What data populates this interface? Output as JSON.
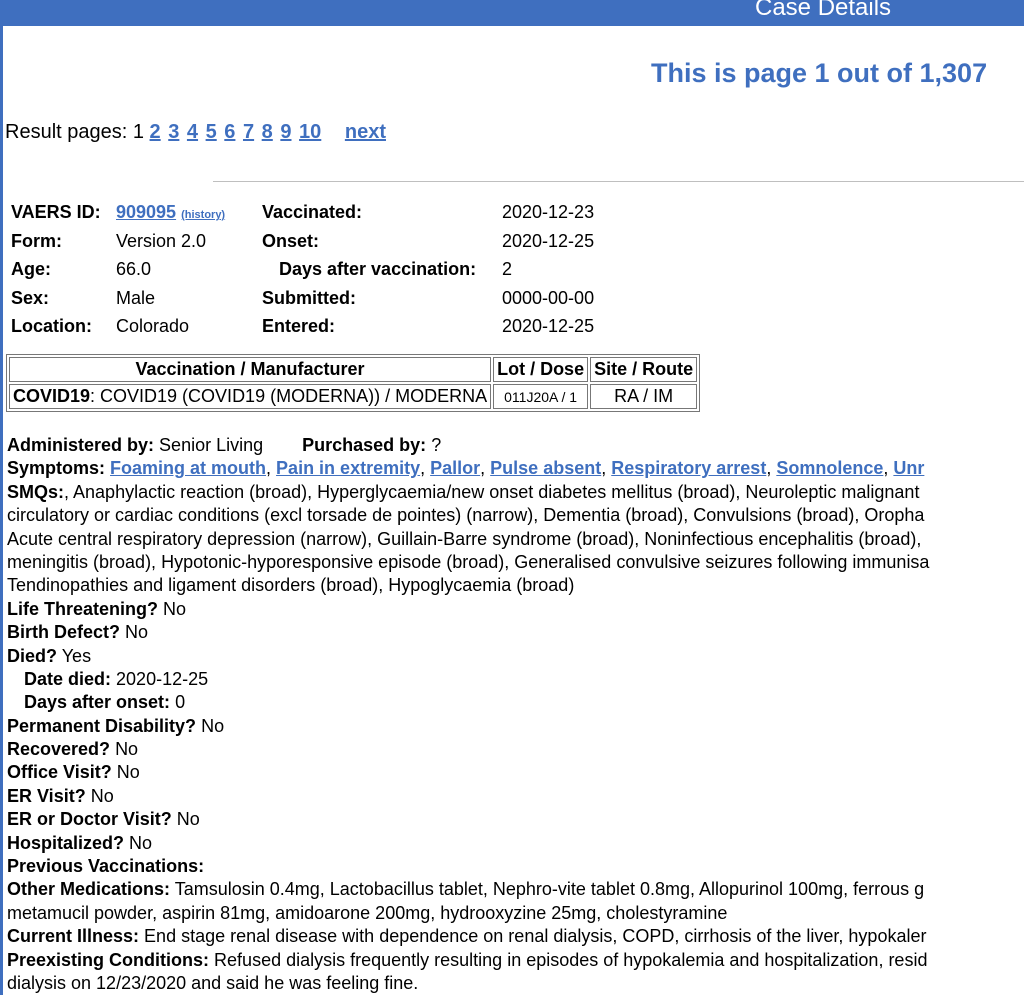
{
  "header": {
    "title": "Case Details"
  },
  "page_count": "This is page 1 out of 1,307",
  "pager": {
    "label": "Result pages:",
    "current": "1",
    "pages": [
      "2",
      "3",
      "4",
      "5",
      "6",
      "7",
      "8",
      "9",
      "10"
    ],
    "next": "next"
  },
  "summary": {
    "vaers_id_label": "VAERS ID:",
    "vaers_id": "909095",
    "history": "(history)",
    "form_label": "Form:",
    "form": "Version 2.0",
    "age_label": "Age:",
    "age": "66.0",
    "sex_label": "Sex:",
    "sex": "Male",
    "location_label": "Location:",
    "location": "Colorado",
    "vaccinated_label": "Vaccinated:",
    "vaccinated": "2020-12-23",
    "onset_label": "Onset:",
    "onset": "2020-12-25",
    "days_after_label": "Days after vaccination:",
    "days_after": "2",
    "submitted_label": "Submitted:",
    "submitted": "0000-00-00",
    "entered_label": "Entered:",
    "entered": "2020-12-25"
  },
  "vax_table": {
    "headers": [
      "Vaccination / Manufacturer",
      "Lot / Dose",
      "Site / Route"
    ],
    "row": {
      "vax": "COVID19",
      "manufacturer": ": COVID19 (COVID19 (MODERNA)) / MODERNA",
      "lot": "011J20A / 1",
      "site": "RA / IM"
    }
  },
  "details": {
    "administered_label": "Administered by:",
    "administered": "Senior Living",
    "purchased_label": "Purchased by:",
    "purchased": "?",
    "symptoms_label": "Symptoms:",
    "symptoms": [
      "Foaming at mouth",
      "Pain in extremity",
      "Pallor",
      "Pulse absent",
      "Respiratory arrest",
      "Somnolence",
      "Unr"
    ],
    "smqs_label": "SMQs:",
    "smqs_lines": [
      ", Anaphylactic reaction (broad), Hyperglycaemia/new onset diabetes mellitus (broad), Neuroleptic malignant",
      "circulatory or cardiac conditions (excl torsade de pointes) (narrow), Dementia (broad), Convulsions (broad), Oropha",
      "Acute central respiratory depression (narrow), Guillain-Barre syndrome (broad), Noninfectious encephalitis (broad),",
      "meningitis (broad), Hypotonic-hyporesponsive episode (broad), Generalised convulsive seizures following immunisa",
      "Tendinopathies and ligament disorders (broad), Hypoglycaemia (broad)"
    ],
    "life_threatening_label": "Life Threatening?",
    "life_threatening": "No",
    "birth_defect_label": "Birth Defect?",
    "birth_defect": "No",
    "died_label": "Died?",
    "died": "Yes",
    "date_died_label": "Date died:",
    "date_died": "2020-12-25",
    "days_after_onset_label": "Days after onset:",
    "days_after_onset": "0",
    "permanent_disability_label": "Permanent Disability?",
    "permanent_disability": "No",
    "recovered_label": "Recovered?",
    "recovered": "No",
    "office_visit_label": "Office Visit?",
    "office_visit": "No",
    "er_visit_label": "ER Visit?",
    "er_visit": "No",
    "er_doctor_label": "ER or Doctor Visit?",
    "er_doctor": "No",
    "hospitalized_label": "Hospitalized?",
    "hospitalized": "No",
    "previous_vax_label": "Previous Vaccinations:",
    "other_meds_label": "Other Medications:",
    "other_meds_1": "Tamsulosin 0.4mg, Lactobacillus tablet, Nephro-vite tablet 0.8mg, Allopurinol 100mg, ferrous g",
    "other_meds_2": "metamucil powder, aspirin 81mg, amidoarone 200mg, hydrooxyzine 25mg, cholestyramine",
    "current_illness_label": "Current Illness:",
    "current_illness": "End stage renal disease with dependence on renal dialysis, COPD, cirrhosis of the liver, hypokaler",
    "preexisting_label": "Preexisting Conditions:",
    "preexisting_1": "Refused dialysis frequently resulting in episodes of hypokalemia and hospitalization, resid",
    "preexisting_2": "dialysis on 12/23/2020 and said he was feeling fine."
  }
}
